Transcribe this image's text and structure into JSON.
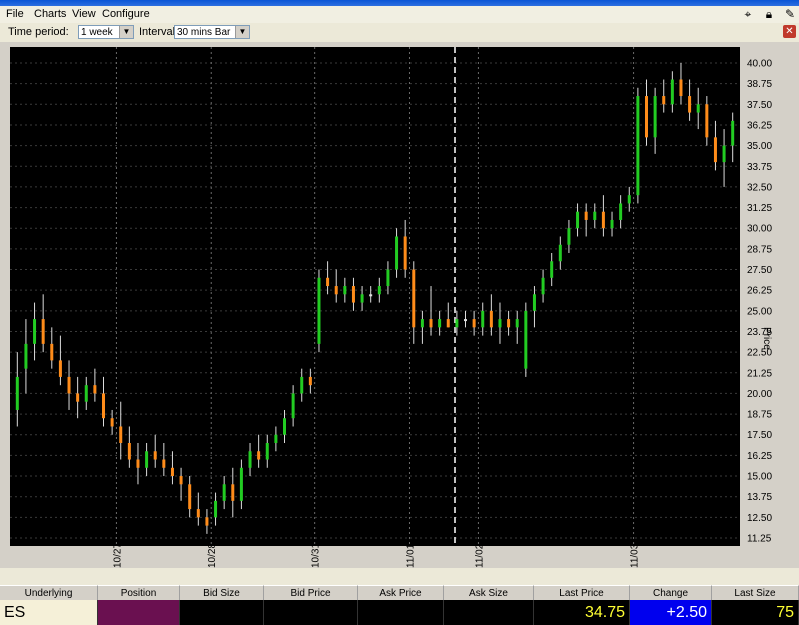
{
  "menu": {
    "file": "File",
    "charts": "Charts",
    "view": "View",
    "configure": "Configure"
  },
  "toolbar": {
    "time_period_label": "Time period:",
    "time_period_value": "1 week",
    "interval_label": "Interval:",
    "interval_value": "30 mins Bar"
  },
  "colors": {
    "up": "#22cc22",
    "down": "#ff8c1a",
    "neutral": "#e0e0e0",
    "background": "#000000",
    "grid": "#3a3a3a"
  },
  "chart_data": {
    "type": "ohlc-bar",
    "ylabel": "Price",
    "ylim": [
      11.25,
      40.0
    ],
    "yticks": [
      "40.00",
      "38.75",
      "37.50",
      "36.25",
      "35.00",
      "33.75",
      "32.50",
      "31.25",
      "30.00",
      "28.75",
      "27.50",
      "26.25",
      "25.00",
      "23.75",
      "22.50",
      "21.25",
      "20.00",
      "18.75",
      "17.50",
      "16.25",
      "15.00",
      "13.75",
      "12.50",
      "11.25"
    ],
    "xlabels": [
      "10/27",
      "10/28",
      "10/31",
      "11/01",
      "11/02",
      "11/03"
    ],
    "bars": [
      [
        19.0,
        22.5,
        18.0,
        21.0
      ],
      [
        21.5,
        24.5,
        20.0,
        23.0
      ],
      [
        23.0,
        25.5,
        22.0,
        24.5
      ],
      [
        24.5,
        26.0,
        22.5,
        23.0
      ],
      [
        23.0,
        24.0,
        21.5,
        22.0
      ],
      [
        22.0,
        23.5,
        20.5,
        21.0
      ],
      [
        21.0,
        22.0,
        19.0,
        20.0
      ],
      [
        20.0,
        21.0,
        18.5,
        19.5
      ],
      [
        19.5,
        21.0,
        19.0,
        20.5
      ],
      [
        20.5,
        21.5,
        19.5,
        20.0
      ],
      [
        20.0,
        21.0,
        18.0,
        18.5
      ],
      [
        18.5,
        19.0,
        17.5,
        18.0
      ],
      [
        18.0,
        19.5,
        16.0,
        17.0
      ],
      [
        17.0,
        18.0,
        15.5,
        16.0
      ],
      [
        16.0,
        17.0,
        14.5,
        15.5
      ],
      [
        15.5,
        17.0,
        15.0,
        16.5
      ],
      [
        16.5,
        17.5,
        15.5,
        16.0
      ],
      [
        16.0,
        17.0,
        15.0,
        15.5
      ],
      [
        15.5,
        16.5,
        14.5,
        15.0
      ],
      [
        15.0,
        15.5,
        13.5,
        14.5
      ],
      [
        14.5,
        15.0,
        12.5,
        13.0
      ],
      [
        13.0,
        14.0,
        12.0,
        12.5
      ],
      [
        12.5,
        13.0,
        11.5,
        12.0
      ],
      [
        12.5,
        14.0,
        12.0,
        13.5
      ],
      [
        13.5,
        15.0,
        13.0,
        14.5
      ],
      [
        14.5,
        15.5,
        12.5,
        13.5
      ],
      [
        13.5,
        16.0,
        13.0,
        15.5
      ],
      [
        15.5,
        17.0,
        15.0,
        16.5
      ],
      [
        16.5,
        17.5,
        15.5,
        16.0
      ],
      [
        16.0,
        17.5,
        15.5,
        17.0
      ],
      [
        17.0,
        18.0,
        16.5,
        17.5
      ],
      [
        17.5,
        19.0,
        17.0,
        18.5
      ],
      [
        18.5,
        20.5,
        18.0,
        20.0
      ],
      [
        20.0,
        21.5,
        19.5,
        21.0
      ],
      [
        21.0,
        21.5,
        20.0,
        20.5
      ],
      [
        23.0,
        27.5,
        22.5,
        27.0
      ],
      [
        27.0,
        28.0,
        26.0,
        26.5
      ],
      [
        26.5,
        27.5,
        25.5,
        26.0
      ],
      [
        26.0,
        27.0,
        25.5,
        26.5
      ],
      [
        26.5,
        27.0,
        25.0,
        25.5
      ],
      [
        25.5,
        26.5,
        25.0,
        26.0
      ],
      [
        26.0,
        26.5,
        25.5,
        26.0
      ],
      [
        26.0,
        27.0,
        25.5,
        26.5
      ],
      [
        26.5,
        28.0,
        26.0,
        27.5
      ],
      [
        27.5,
        30.0,
        27.0,
        29.5
      ],
      [
        29.5,
        30.5,
        27.0,
        27.5
      ],
      [
        27.5,
        28.0,
        23.0,
        24.0
      ],
      [
        24.0,
        25.0,
        23.0,
        24.5
      ],
      [
        24.5,
        26.5,
        23.5,
        24.0
      ],
      [
        24.0,
        25.0,
        23.5,
        24.5
      ],
      [
        24.5,
        25.5,
        24.0,
        24.0
      ],
      [
        24.0,
        25.0,
        23.5,
        24.5
      ],
      [
        24.5,
        25.0,
        24.0,
        24.5
      ],
      [
        24.5,
        25.0,
        23.5,
        24.0
      ],
      [
        24.0,
        25.5,
        23.5,
        25.0
      ],
      [
        25.0,
        26.0,
        23.5,
        24.0
      ],
      [
        24.0,
        25.5,
        23.0,
        24.5
      ],
      [
        24.5,
        25.0,
        23.5,
        24.0
      ],
      [
        24.0,
        25.0,
        23.0,
        24.5
      ],
      [
        21.5,
        25.5,
        21.0,
        25.0
      ],
      [
        25.0,
        26.5,
        24.0,
        26.0
      ],
      [
        26.0,
        27.5,
        25.5,
        27.0
      ],
      [
        27.0,
        28.5,
        26.5,
        28.0
      ],
      [
        28.0,
        29.5,
        27.5,
        29.0
      ],
      [
        29.0,
        30.5,
        28.5,
        30.0
      ],
      [
        30.0,
        31.5,
        29.5,
        31.0
      ],
      [
        31.0,
        31.5,
        29.5,
        30.5
      ],
      [
        30.5,
        31.5,
        30.0,
        31.0
      ],
      [
        31.0,
        32.0,
        29.5,
        30.0
      ],
      [
        30.0,
        31.0,
        29.5,
        30.5
      ],
      [
        30.5,
        32.0,
        30.0,
        31.5
      ],
      [
        31.5,
        32.5,
        31.0,
        32.0
      ],
      [
        32.0,
        38.5,
        31.5,
        38.0
      ],
      [
        38.0,
        39.0,
        35.0,
        35.5
      ],
      [
        35.5,
        38.5,
        34.5,
        38.0
      ],
      [
        38.0,
        39.0,
        37.0,
        37.5
      ],
      [
        37.5,
        39.5,
        37.0,
        39.0
      ],
      [
        39.0,
        40.0,
        37.5,
        38.0
      ],
      [
        38.0,
        39.0,
        36.5,
        37.0
      ],
      [
        37.0,
        38.5,
        36.0,
        37.5
      ],
      [
        37.5,
        38.0,
        35.0,
        35.5
      ],
      [
        35.5,
        36.5,
        33.5,
        34.0
      ],
      [
        34.0,
        36.0,
        32.5,
        35.0
      ],
      [
        35.0,
        37.0,
        34.0,
        36.5
      ]
    ],
    "day_bar_index": [
      12,
      23,
      35,
      46,
      54,
      72
    ]
  },
  "status": {
    "headers": [
      "Underlying",
      "Position",
      "Bid Size",
      "Bid Price",
      "Ask Price",
      "Ask Size",
      "Last Price",
      "Change",
      "Last Size"
    ],
    "underlying": "ES",
    "position": "",
    "bid_size": "",
    "bid_price": "",
    "ask_price": "",
    "ask_size": "",
    "last_price": "34.75",
    "change": "+2.50",
    "last_size": "75"
  }
}
